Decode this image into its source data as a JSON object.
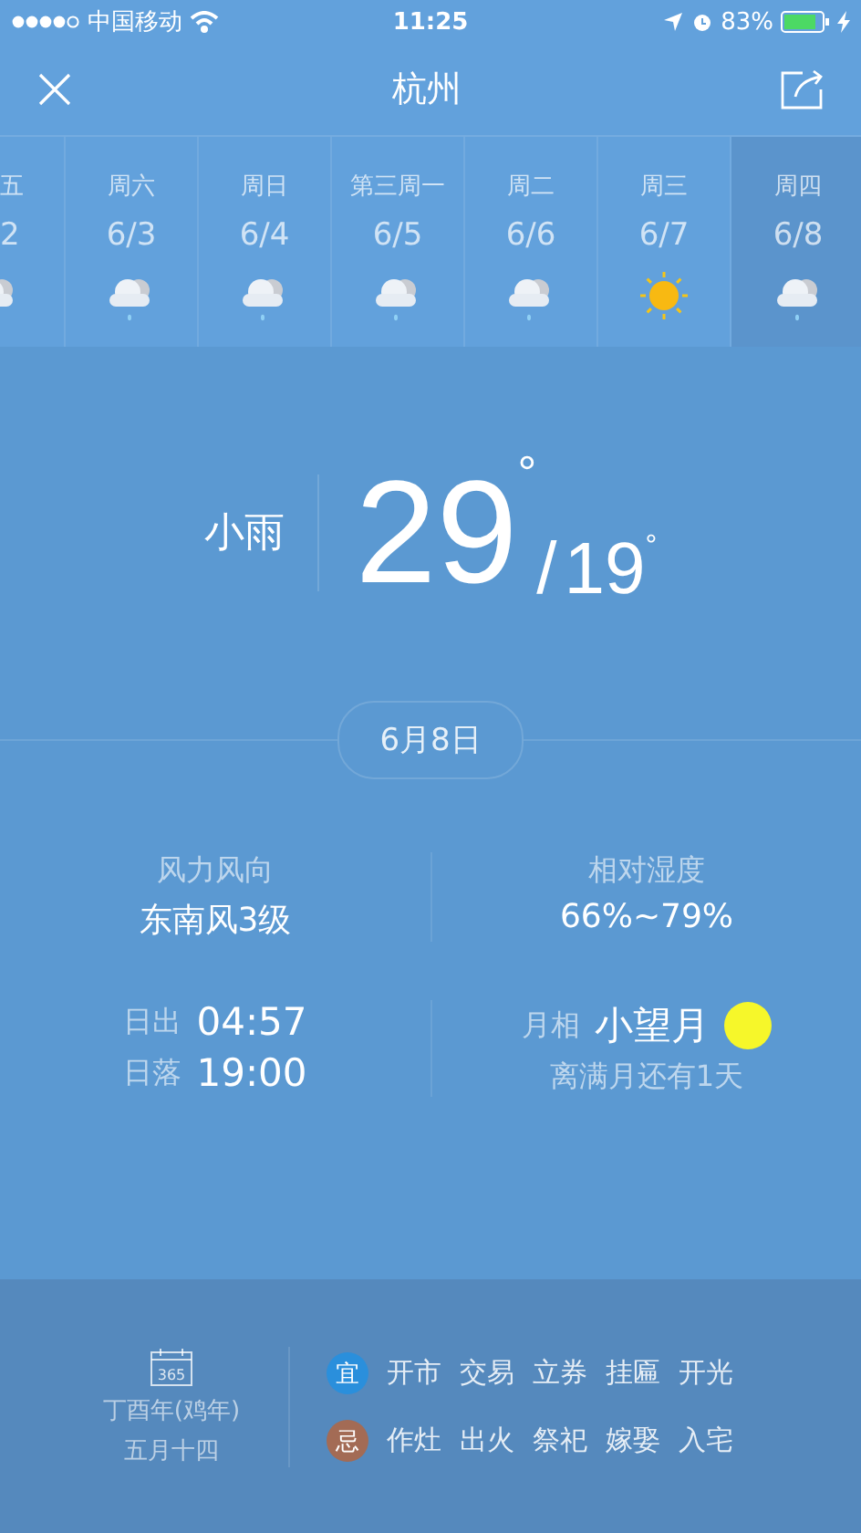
{
  "status_bar": {
    "carrier": "中国移动",
    "time": "11:25",
    "battery": "83%"
  },
  "header": {
    "title": "杭州"
  },
  "days": [
    {
      "weekday": "五",
      "date": "2",
      "kind": "rain",
      "selected": false,
      "partial": true
    },
    {
      "weekday": "周六",
      "date": "6/3",
      "kind": "rain",
      "selected": false,
      "partial": false
    },
    {
      "weekday": "周日",
      "date": "6/4",
      "kind": "rain",
      "selected": false,
      "partial": false
    },
    {
      "weekday": "第三周一",
      "date": "6/5",
      "kind": "rain",
      "selected": false,
      "partial": false
    },
    {
      "weekday": "周二",
      "date": "6/6",
      "kind": "rain",
      "selected": false,
      "partial": false
    },
    {
      "weekday": "周三",
      "date": "6/7",
      "kind": "sunny",
      "selected": false,
      "partial": false
    },
    {
      "weekday": "周四",
      "date": "6/8",
      "kind": "rain",
      "selected": true,
      "partial": false
    }
  ],
  "current": {
    "condition": "小雨",
    "high": "29$^{°}$",
    "separator": "/",
    "low": "19$^{°}$",
    "date": "6月8日"
  },
  "details": {
    "wind_label": "风力风向",
    "wind": "东南风3级",
    "humidity_label": "相对湿度",
    "humidity": "66%~79%",
    "sunrise_label": "日出",
    "sunrise": "04:57",
    "sunset_label": "日落",
    "sunset": "19:00",
    "moon_label": "月相",
    "moon": "小望月",
    "moon_note": "离满月还有1天"
  },
  "almanac": {
    "calendar_icon_text": "365",
    "lunar_year": "丁酉年(鸡年)",
    "lunar_day": "五月十四",
    "rows": [
      {
        "badge": "宜",
        "color": "#2a8fdc",
        "items": [
          "开市",
          "交易",
          "立券",
          "挂匾",
          "开光"
        ]
      },
      {
        "badge": "忌",
        "color": "#a36b55",
        "items": [
          "作灶",
          "出火",
          "祭祀",
          "嫁娶",
          "入宅"
        ]
      }
    ]
  }
}
